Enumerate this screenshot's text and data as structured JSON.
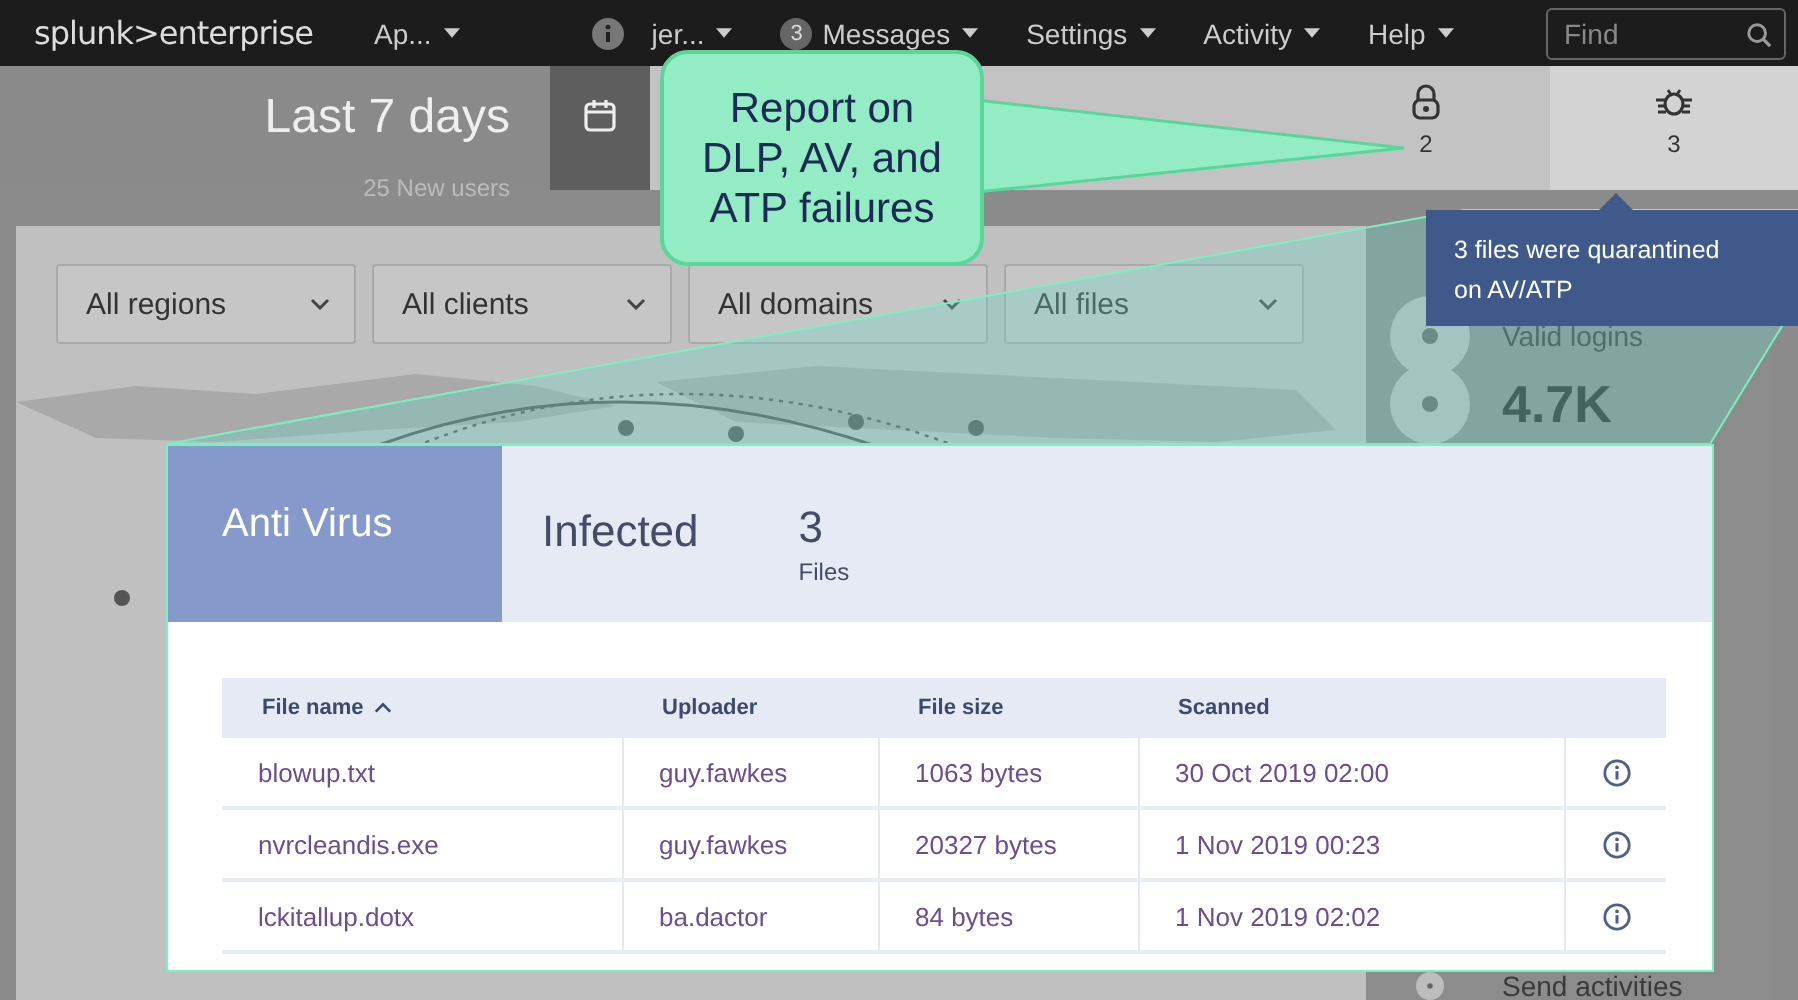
{
  "navbar": {
    "logo": "splunk>enterprise",
    "menus": [
      {
        "label": "Ap...",
        "kind": "plain"
      },
      {
        "label": "jer...",
        "kind": "user"
      },
      {
        "label": "Messages",
        "kind": "badge",
        "badge": "3"
      },
      {
        "label": "Settings",
        "kind": "plain"
      },
      {
        "label": "Activity",
        "kind": "plain"
      },
      {
        "label": "Help",
        "kind": "plain"
      }
    ],
    "search": {
      "placeholder": "Find"
    }
  },
  "header": {
    "period": "Last 7 days",
    "subtitle": "25 New users",
    "stat_tabs": [
      {
        "kind": "lock",
        "count": "2",
        "selected": false
      },
      {
        "kind": "bug",
        "count": "3",
        "selected": true
      }
    ]
  },
  "filters": [
    {
      "value": "All regions"
    },
    {
      "value": "All clients"
    },
    {
      "value": "All domains"
    },
    {
      "value": "All files"
    }
  ],
  "side_stats": [
    {
      "kind": "label",
      "text": "Valid logins"
    },
    {
      "kind": "value",
      "text": "4.7K"
    },
    {
      "kind": "label",
      "text": "Send activities"
    }
  ],
  "callout": {
    "text": "Report on DLP, AV, and ATP failures"
  },
  "tooltip": {
    "text": "3 files were quarantined on AV/ATP"
  },
  "detail": {
    "title": "Anti Virus",
    "status": "Infected",
    "count": "3",
    "count_unit": "Files",
    "table": {
      "columns": [
        {
          "label": "File name",
          "sorted": true
        },
        {
          "label": "Uploader",
          "sorted": false
        },
        {
          "label": "File size",
          "sorted": false
        },
        {
          "label": "Scanned",
          "sorted": false
        }
      ],
      "rows": [
        [
          "blowup.txt",
          "guy.fawkes",
          "1063 bytes",
          "30 Oct 2019 02:00"
        ],
        [
          "nvrcleandis.exe",
          "guy.fawkes",
          "20327 bytes",
          "1 Nov 2019 00:23"
        ],
        [
          "lckitallup.dotx",
          "ba.dactor",
          "84 bytes",
          "1 Nov 2019 02:02"
        ]
      ]
    }
  }
}
